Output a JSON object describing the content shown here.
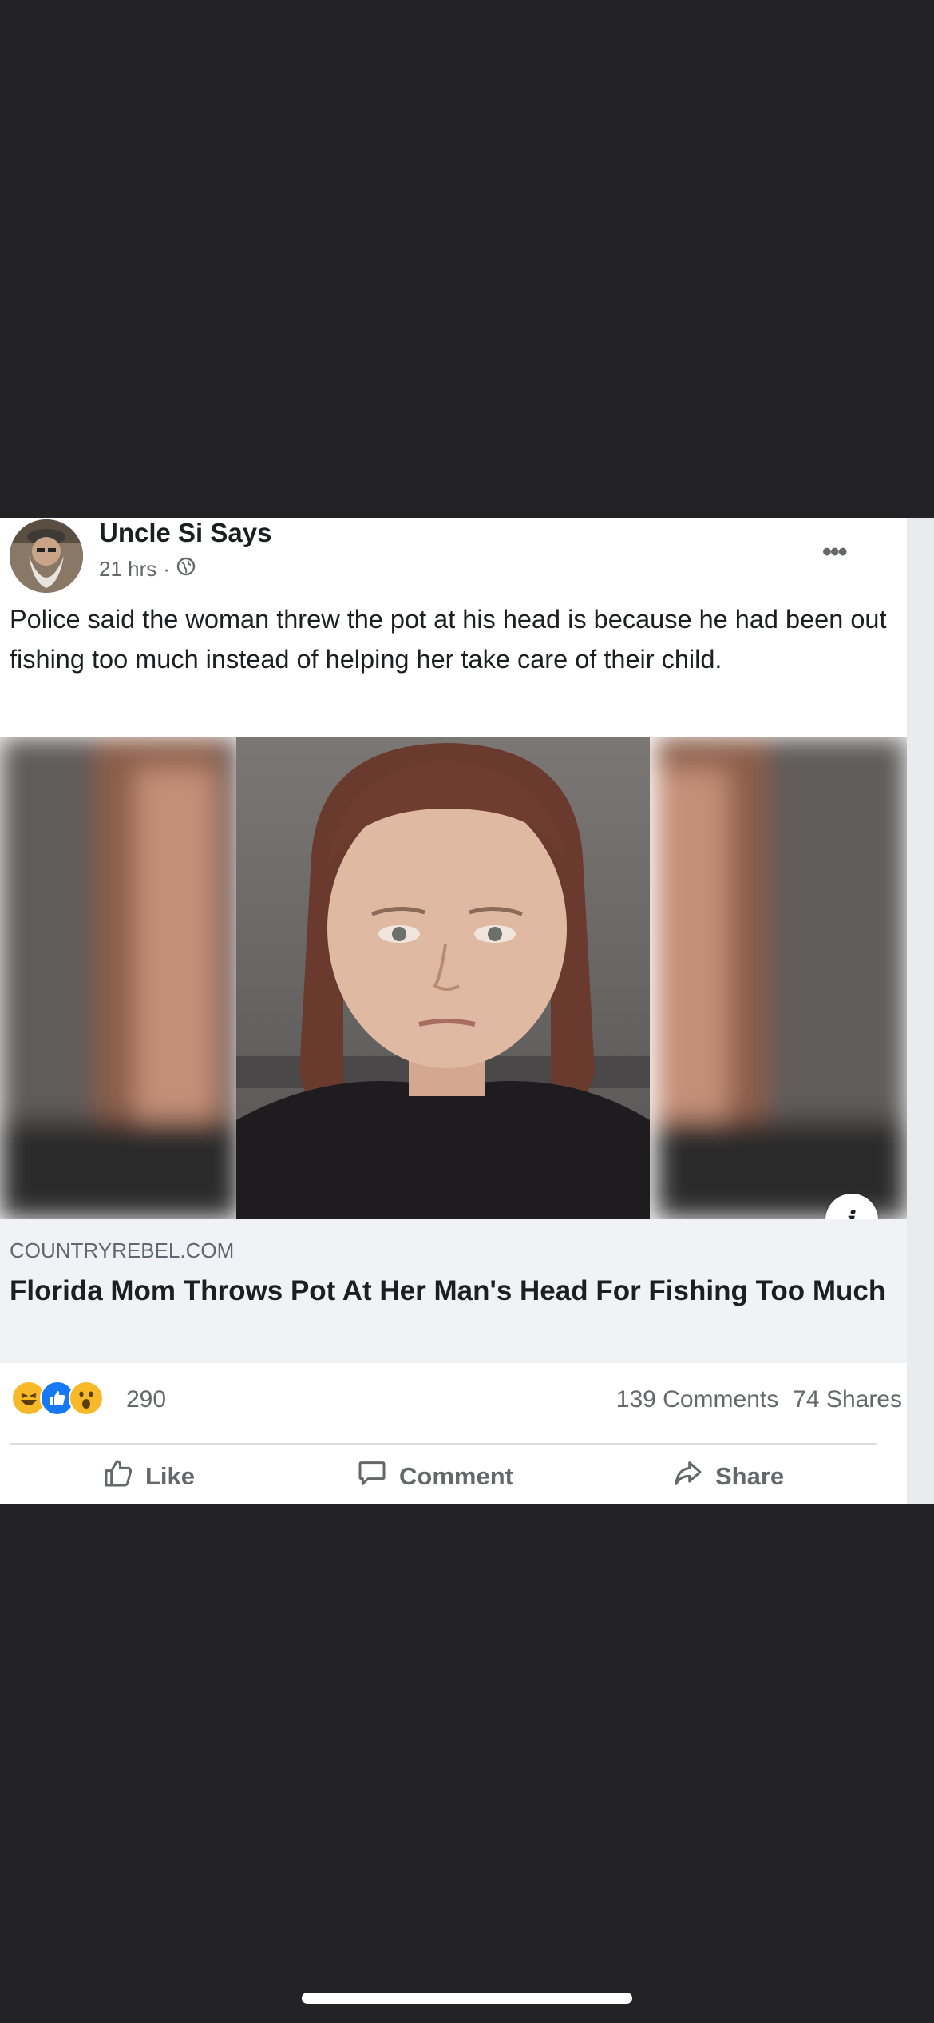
{
  "post": {
    "author": "Uncle Si Says",
    "timestamp": "21 hrs",
    "separator": "·",
    "privacy_icon": "globe-icon",
    "more_label": "•••",
    "text": "Police said the woman threw the pot at his head is because he had been out fishing too much instead of helping her take care of their child."
  },
  "link": {
    "domain": "COUNTRYREBEL.COM",
    "headline": "Florida Mom Throws Pot At Her Man's Head For Fishing Too Much",
    "info_label": "i"
  },
  "engagement": {
    "reaction_icons": [
      "haha-icon",
      "like-icon",
      "wow-icon"
    ],
    "reaction_count": "290",
    "comments": "139 Comments",
    "shares": "74 Shares"
  },
  "actions": {
    "like": "Like",
    "comment": "Comment",
    "share": "Share"
  },
  "colors": {
    "background": "#232326",
    "card": "#ffffff",
    "link_box": "#f0f2f5",
    "secondary_text": "#65676b",
    "like_blue": "#1877f2",
    "reaction_yellow": "#f7b928"
  }
}
